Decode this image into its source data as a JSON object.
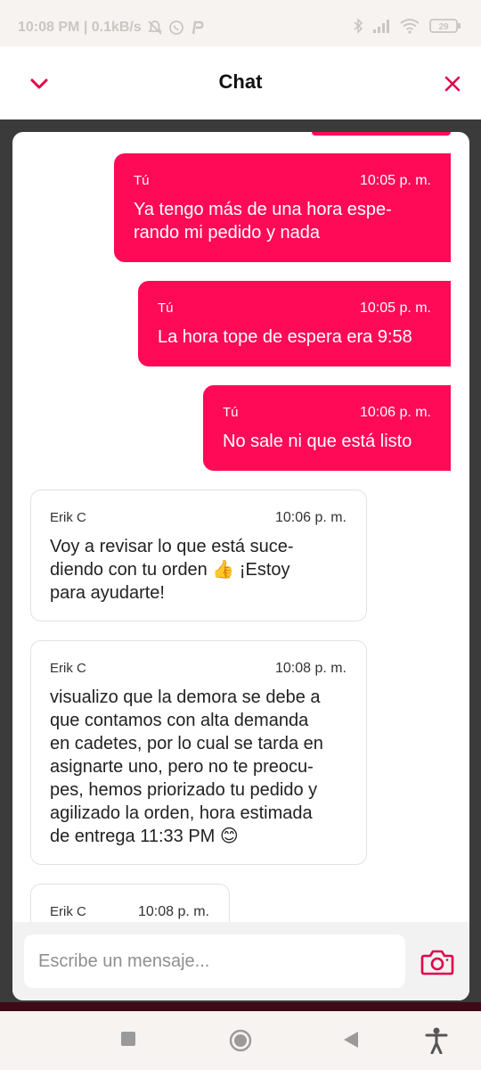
{
  "status_bar": {
    "time_speed": "10:08 PM | 0.1kB/s",
    "battery": "29"
  },
  "header": {
    "title": "Chat",
    "back_icon": "chevron-down-icon",
    "close_icon": "close-icon"
  },
  "messages": [
    {
      "sender": "Tú",
      "time": "10:05 p. m.",
      "text": "Ya tengo más de una hora espe-\nrando mi pedido y nada",
      "mine": true
    },
    {
      "sender": "Tú",
      "time": "10:05 p. m.",
      "text": "La hora tope de espera era 9:58",
      "mine": true
    },
    {
      "sender": "Tú",
      "time": "10:06 p. m.",
      "text": "No sale ni que está listo",
      "mine": true
    },
    {
      "sender": "Erik C",
      "time": "10:06 p. m.",
      "text": "Voy a revisar lo que está suce-\ndiendo con tu orden 👍 ¡Estoy\npara ayudarte!",
      "mine": false
    },
    {
      "sender": "Erik C",
      "time": "10:08 p. m.",
      "text": "visualizo que la demora se debe a\nque contamos con alta demanda\nen cadetes, por lo cual se tarda en\nasignarte uno, pero no te preocu-\npes, hemos priorizado tu pedido y\nagilizado la orden, hora estimada\nde entrega 11:33 PM 😊",
      "mine": false
    },
    {
      "sender": "Erik C",
      "time": "10:08 p. m.",
      "text": "",
      "mine": false
    }
  ],
  "input": {
    "placeholder": "Escribe un mensaje...",
    "value": ""
  },
  "colors": {
    "accent": "#ff0a57",
    "background": "#3b3b3b"
  },
  "nav_icons": [
    "recent-apps-icon",
    "home-icon",
    "back-icon",
    "accessibility-icon"
  ]
}
